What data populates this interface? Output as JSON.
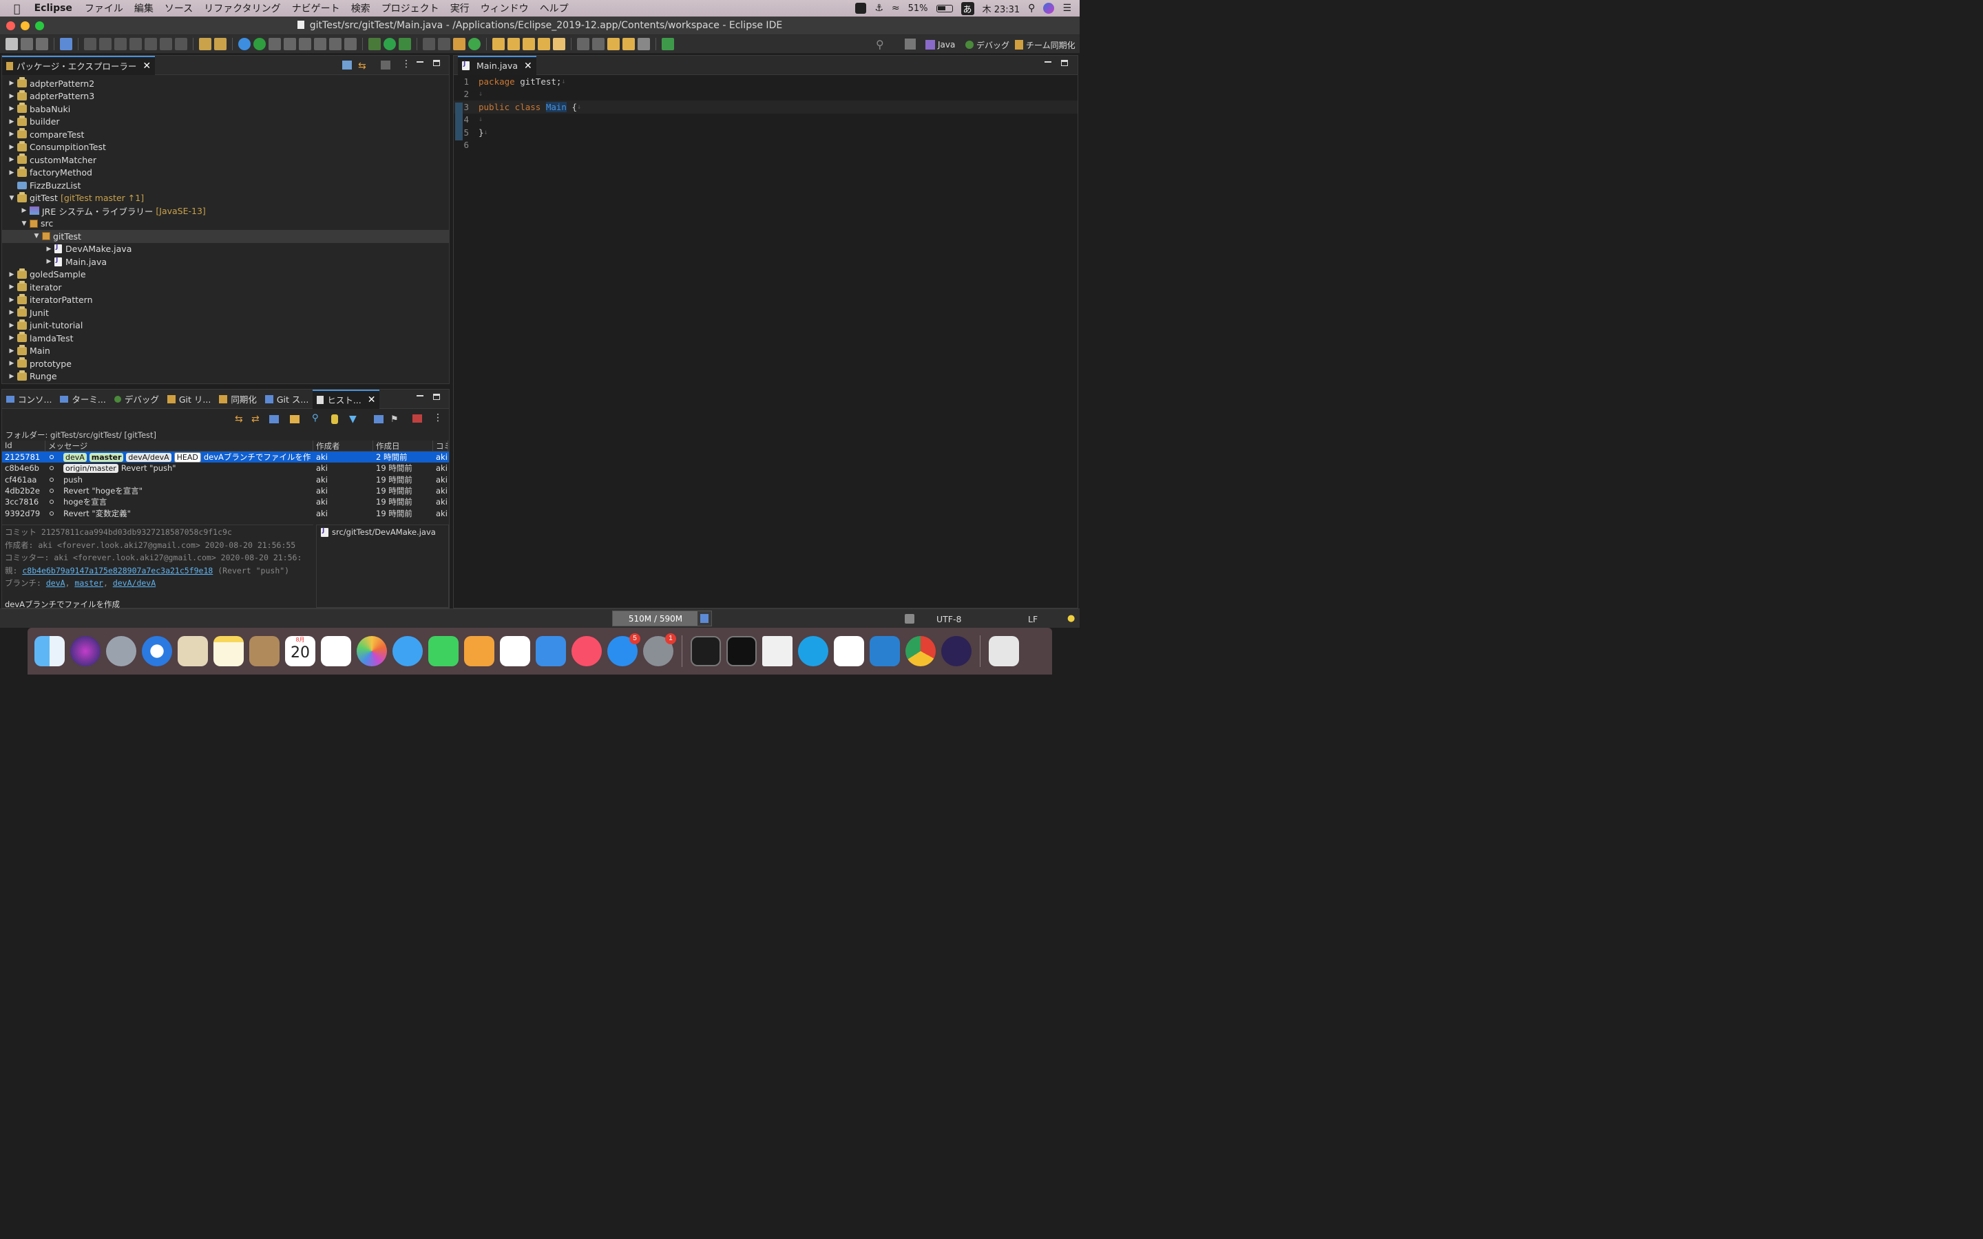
{
  "menubar": {
    "app_name": "Eclipse",
    "items": [
      "ファイル",
      "編集",
      "ソース",
      "リファクタリング",
      "ナビゲート",
      "検索",
      "プロジェクト",
      "実行",
      "ウィンドウ",
      "ヘルプ"
    ],
    "battery": "51%",
    "input_method": "あ",
    "clock": "木 23:31"
  },
  "window": {
    "title": "gitTest/src/gitTest/Main.java - /Applications/Eclipse_2019-12.app/Contents/workspace - Eclipse IDE"
  },
  "toolbar": {
    "perspectives": [
      "Java",
      "デバッグ",
      "チーム同期化"
    ]
  },
  "package_explorer": {
    "tab_label": "パッケージ・エクスプローラー",
    "items": [
      {
        "label": "adpterPattern2"
      },
      {
        "label": "adpterPattern3"
      },
      {
        "label": "babaNuki"
      },
      {
        "label": "builder"
      },
      {
        "label": "compareTest"
      },
      {
        "label": "ConsumpitionTest"
      },
      {
        "label": "customMatcher"
      },
      {
        "label": "factoryMethod"
      },
      {
        "label": "FizzBuzzList"
      },
      {
        "label": "gitTest",
        "decoration": "[gitTest master ↑1]"
      },
      {
        "label": "JRE システム・ライブラリー",
        "decoration": "[JavaSE-13]"
      },
      {
        "label": "src"
      },
      {
        "label": "gitTest"
      },
      {
        "label": "DevAMake.java"
      },
      {
        "label": "Main.java"
      },
      {
        "label": "goledSample"
      },
      {
        "label": "iterator"
      },
      {
        "label": "iteratorPattern"
      },
      {
        "label": "Junit"
      },
      {
        "label": "junit-tutorial"
      },
      {
        "label": "lamdaTest"
      },
      {
        "label": "Main"
      },
      {
        "label": "prototype"
      },
      {
        "label": "Runge"
      }
    ]
  },
  "editor": {
    "tab_label": "Main.java",
    "line_numbers": [
      "1",
      "2",
      "3",
      "4",
      "5",
      "6"
    ],
    "code": {
      "l1_kw": "package",
      "l1_rest": " gitTest;",
      "l3_kw": "public class",
      "l3_cls": "Main",
      "l3_rest": " {",
      "l5": "}"
    }
  },
  "bottom_tabs": [
    "コンソ...",
    "ターミ...",
    "デバッグ",
    "Git リ...",
    "同期化",
    "Git ス...",
    "ヒスト..."
  ],
  "history": {
    "folder_label": "フォルダー: gitTest/src/gitTest/ [gitTest]",
    "columns": [
      "Id",
      "メッセージ",
      "作成者",
      "作成日",
      "コミ"
    ],
    "rows": [
      {
        "id": "2125781",
        "refs": [
          "devA",
          "master",
          "devA/devA",
          "HEAD"
        ],
        "message": "devAブランチでファイルを作",
        "author": "aki",
        "date": "2 時間前",
        "committer": "aki"
      },
      {
        "id": "c8b4e6b",
        "refs": [
          "origin/master"
        ],
        "message": "Revert \"push\"",
        "author": "aki",
        "date": "19 時間前",
        "committer": "aki"
      },
      {
        "id": "cf461aa",
        "refs": [],
        "message": "push",
        "author": "aki",
        "date": "19 時間前",
        "committer": "aki"
      },
      {
        "id": "4db2b2e",
        "refs": [],
        "message": "Revert \"hogeを宣言\"",
        "author": "aki",
        "date": "19 時間前",
        "committer": "aki"
      },
      {
        "id": "3cc7816",
        "refs": [],
        "message": "hogeを宣言",
        "author": "aki",
        "date": "19 時間前",
        "committer": "aki"
      },
      {
        "id": "9392d79",
        "refs": [],
        "message": "Revert \"変数定義\"",
        "author": "aki",
        "date": "19 時間前",
        "committer": "aki"
      }
    ],
    "detail": {
      "commit": "コミット 21257811caa994bd03db9327218587058c9f1c9c",
      "author": "作成者: aki <forever.look.aki27@gmail.com> 2020-08-20 21:56:55",
      "committer": "コミッター: aki <forever.look.aki27@gmail.com> 2020-08-20 21:56:",
      "parent_label": "親: ",
      "parent_hash": "c8b4e6b79a9147a175e828907a7ec3a21c5f9e18",
      "parent_msg": " (Revert \"push\")",
      "branch_label": "ブランチ: ",
      "branches": [
        "devA",
        "master",
        "devA/devA"
      ],
      "message": "devAブランチでファイルを作成"
    },
    "files": [
      "src/gitTest/DevAMake.java"
    ]
  },
  "status": {
    "heap": "510M / 590M",
    "encoding": "UTF-8",
    "line_ending": "LF"
  },
  "dock": {
    "calendar_month": "8月",
    "calendar_day": "20",
    "appstore_badge": "5",
    "settings_badge": "1"
  }
}
